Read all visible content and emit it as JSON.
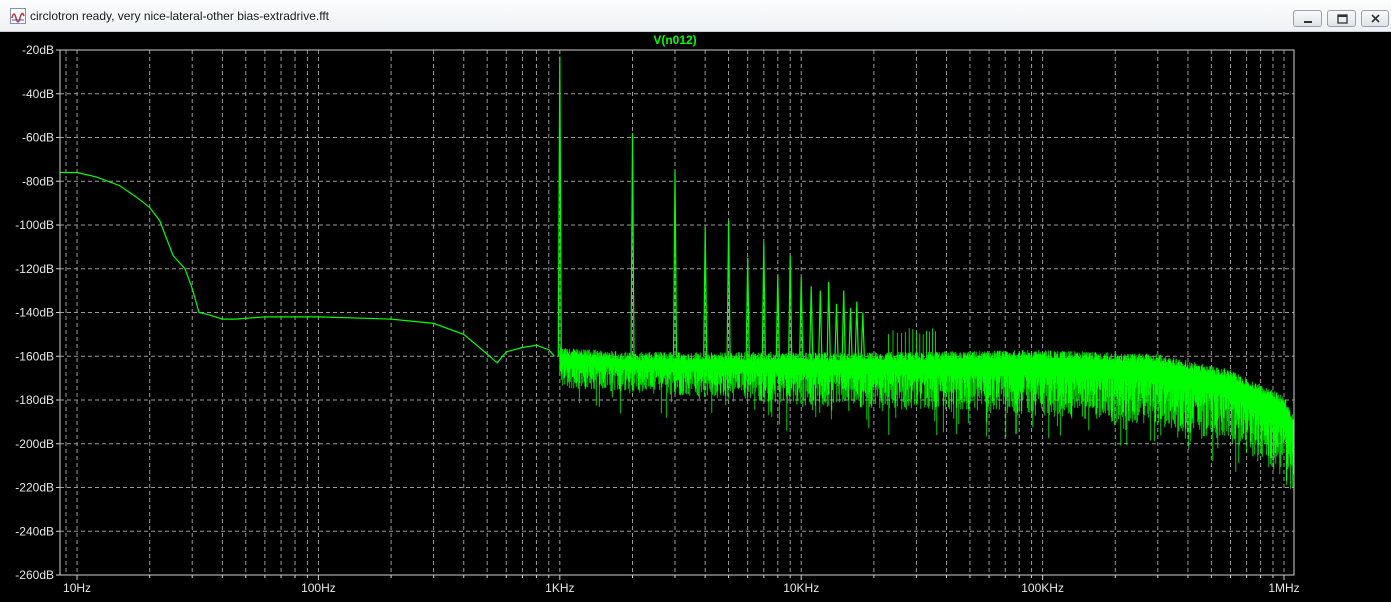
{
  "window": {
    "title": "circlotron ready, very nice-lateral-other bias-extradrive.fft",
    "app_icon": "waveform-app-icon",
    "controls": [
      "minimize-icon",
      "restore-icon",
      "close-icon"
    ]
  },
  "colors": {
    "trace": "#00ff00",
    "grid": "#9a9a9a",
    "axis_text": "#e6e6e6",
    "background": "#000000"
  },
  "chart_data": {
    "type": "line",
    "title": "V(n012)",
    "xlabel": "",
    "ylabel": "",
    "x_scale": "log",
    "xlim": [
      8.5,
      1100000
    ],
    "ylim": [
      -260,
      -20
    ],
    "grid": true,
    "x_ticks": [
      {
        "value": 10,
        "label": "10Hz"
      },
      {
        "value": 100,
        "label": "100Hz"
      },
      {
        "value": 1000,
        "label": "1KHz"
      },
      {
        "value": 10000,
        "label": "10KHz"
      },
      {
        "value": 100000,
        "label": "100KHz"
      },
      {
        "value": 1000000,
        "label": "1MHz"
      }
    ],
    "y_ticks": [
      {
        "value": -20,
        "label": "-20dB"
      },
      {
        "value": -40,
        "label": "-40dB"
      },
      {
        "value": -60,
        "label": "-60dB"
      },
      {
        "value": -80,
        "label": "-80dB"
      },
      {
        "value": -100,
        "label": "-100dB"
      },
      {
        "value": -120,
        "label": "-120dB"
      },
      {
        "value": -140,
        "label": "-140dB"
      },
      {
        "value": -160,
        "label": "-160dB"
      },
      {
        "value": -180,
        "label": "-180dB"
      },
      {
        "value": -200,
        "label": "-200dB"
      },
      {
        "value": -220,
        "label": "-220dB"
      },
      {
        "value": -240,
        "label": "-240dB"
      },
      {
        "value": -260,
        "label": "-260dB"
      }
    ],
    "series": [
      {
        "name": "V(n012)",
        "x": [
          8.5,
          10,
          12,
          15,
          18,
          20,
          22,
          25,
          28,
          30,
          32,
          35,
          40,
          45,
          60,
          100,
          200,
          300,
          400,
          500,
          550,
          600,
          700,
          800,
          900,
          950
        ],
        "y": [
          -76,
          -76,
          -78,
          -82,
          -88,
          -92,
          -98,
          -114,
          -120,
          -129,
          -140,
          -141,
          -143,
          -143,
          -142,
          -142,
          -143,
          -145,
          -150,
          -159,
          -163,
          -158,
          -156,
          -155,
          -157,
          -160
        ]
      }
    ],
    "harmonics": [
      {
        "x": 1000,
        "y": -23
      },
      {
        "x": 2000,
        "y": -58
      },
      {
        "x": 3000,
        "y": -75
      },
      {
        "x": 4000,
        "y": -101
      },
      {
        "x": 5000,
        "y": -98
      },
      {
        "x": 6000,
        "y": -115
      },
      {
        "x": 7000,
        "y": -108
      },
      {
        "x": 8000,
        "y": -123
      },
      {
        "x": 9000,
        "y": -114
      },
      {
        "x": 10000,
        "y": -124
      },
      {
        "x": 11000,
        "y": -128
      },
      {
        "x": 12000,
        "y": -130
      },
      {
        "x": 13000,
        "y": -126
      },
      {
        "x": 14000,
        "y": -136
      },
      {
        "x": 15000,
        "y": -130
      },
      {
        "x": 16000,
        "y": -138
      },
      {
        "x": 17000,
        "y": -135
      },
      {
        "x": 18000,
        "y": -140
      }
    ],
    "noise_floor": {
      "x": [
        1000,
        2000,
        5000,
        10000,
        30000,
        100000,
        300000,
        600000,
        1000000,
        1100000
      ],
      "upper": [
        -158,
        -160,
        -160,
        -160,
        -160,
        -159,
        -161,
        -168,
        -180,
        -190
      ],
      "lower": [
        -180,
        -182,
        -186,
        -190,
        -193,
        -197,
        -202,
        -210,
        -228,
        -240
      ]
    }
  }
}
